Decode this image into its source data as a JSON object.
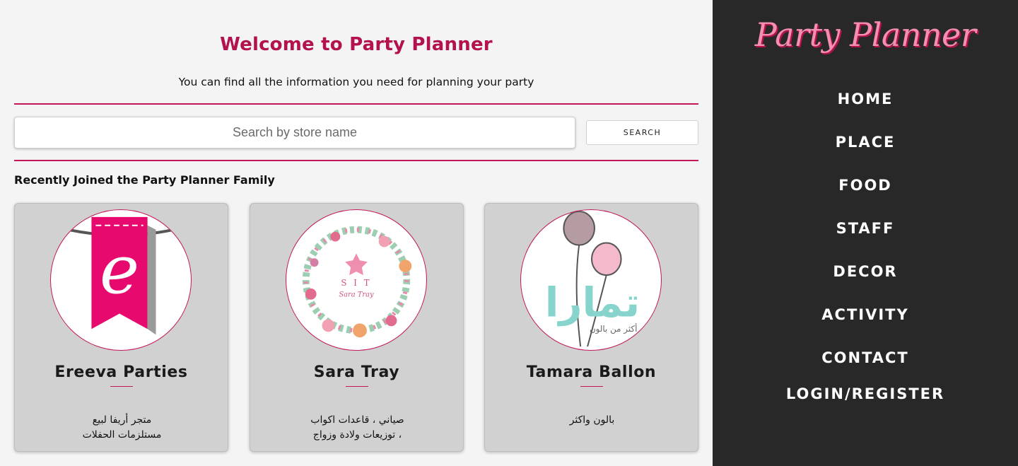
{
  "main": {
    "title": "Welcome to Party Planner",
    "subtitle": "You can find all the information you need for planning your party",
    "search": {
      "placeholder": "Search by store name",
      "value": "",
      "button_label": "SEARCH"
    },
    "section_title": "Recently Joined the Party Planner Family",
    "cards": [
      {
        "name": "Ereeva Parties",
        "desc_line1": "متجر أريفا لبيع",
        "desc_line2": "مستلزمات الحفلات",
        "logo_text": "e",
        "logo_icon": "ereeva-banner-logo-icon"
      },
      {
        "name": "Sara Tray",
        "desc_line1": "صياني ، قاعدات اكواب",
        "desc_line2": "، توزيعات ولادة وزواج",
        "logo_text_1": "S I T",
        "logo_text_2": "Sara Tray",
        "logo_icon": "floral-wreath-logo-icon"
      },
      {
        "name": "Tamara Ballon",
        "desc_line1": "بالون واكثر",
        "desc_line2": "",
        "logo_text_1": "تمارا",
        "logo_text_2": "أكثر من بالون",
        "logo_icon": "balloon-logo-icon"
      }
    ]
  },
  "sidebar": {
    "brand": "Party Planner",
    "nav": [
      "HOME",
      "PLACE",
      "FOOD",
      "STAFF",
      "DECOR",
      "ACTIVITY",
      "CONTACT",
      "LOGIN/REGISTER"
    ]
  },
  "colors": {
    "accent": "#b3124e",
    "sidebar_bg": "#282828",
    "card_bg": "#d1d1d1",
    "brand_pink": "#f48fb1"
  }
}
